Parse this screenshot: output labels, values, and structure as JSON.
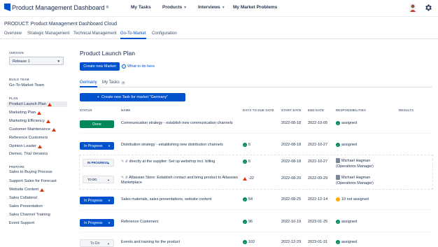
{
  "header": {
    "app_title": "Product Management Dashboard",
    "app_mark": "®",
    "nav": [
      {
        "label": "My Tasks",
        "dropdown": false
      },
      {
        "label": "Products",
        "dropdown": true
      },
      {
        "label": "Interviews",
        "dropdown": true
      },
      {
        "label": "My Market Problems",
        "dropdown": false
      }
    ]
  },
  "breadcrumb": "PRODUCT: Product Management Dashboard Cloud",
  "tabs": [
    {
      "label": "Overview",
      "active": false
    },
    {
      "label": "Strategic Management",
      "active": false
    },
    {
      "label": "Technical Management",
      "active": false
    },
    {
      "label": "Go-To-Market",
      "active": true
    },
    {
      "label": "Configuration",
      "active": false
    }
  ],
  "sidebar": {
    "version_heading": "VERSION",
    "version_value": "Release 1",
    "build_heading": "BUILD TEAM",
    "build_items": [
      "Go-To-Market Team"
    ],
    "plan_heading": "PLAN",
    "plan_items": [
      {
        "label": "Product Launch Plan",
        "warning": true,
        "selected": true
      },
      {
        "label": "Marketing Plan",
        "warning": true
      },
      {
        "label": "Marketing Efficiency",
        "warning": true
      },
      {
        "label": "Customer Maintenance",
        "warning": true
      },
      {
        "label": "Reference Customers",
        "warning": false
      },
      {
        "label": "Opinion Leader",
        "warning": true
      },
      {
        "label": "Demos, Trial Versions",
        "warning": false
      }
    ],
    "prepare_heading": "PREPARE",
    "prepare_items": [
      {
        "label": "Sales to Buying Process",
        "warning": false
      },
      {
        "label": "Support Sales for Forecast",
        "warning": false
      },
      {
        "label": "Website Content",
        "warning": true
      },
      {
        "label": "Sales Collateral",
        "warning": false
      },
      {
        "label": "Sales Presentation",
        "warning": false
      },
      {
        "label": "Sales Channel Training",
        "warning": false
      },
      {
        "label": "Event Support",
        "warning": false
      }
    ]
  },
  "main": {
    "title": "Product Launch Plan",
    "create_market_label": "Create new Market",
    "what_to_do_label": "What to do here",
    "subtabs": [
      {
        "label": "Germany",
        "active": true
      },
      {
        "label": "My Tasks",
        "count": "7",
        "active": false
      }
    ],
    "create_task_label": "Create new Task for market \"Germany\"",
    "columns": [
      "STATUS",
      "NAME",
      "DAYS TO DUE DATE",
      "START DATE",
      "END DATE",
      "RESPONSIBILITIES",
      "RESULTS"
    ],
    "rows": [
      {
        "status": "Done",
        "status_type": "done",
        "name": "Communication strategy - establish new communication channels",
        "days": "",
        "start": "2022-08-18",
        "end": "2022-10-05",
        "resp": "assigned",
        "resp_type": "ok"
      },
      {
        "status": "In Progress",
        "status_type": "progress",
        "name": "Distribution strategy - establishing new distribution channels",
        "days": "6",
        "start": "2022-08-18",
        "end": "2022-10-27",
        "resp": "assigned",
        "resp_type": "ok"
      },
      {
        "status": "IN PROGRESS",
        "status_type": "sub",
        "name": "directly at the supplier: Set up webshop incl. billing",
        "days": "6",
        "start": "2022-08-18",
        "end": "2022-10-27",
        "resp": "Michael Hagman",
        "resp2": "(Operations Manager)",
        "resp_type": "person"
      },
      {
        "status": "TO DO",
        "status_type": "subtodo",
        "name": "Atlassian Store: Establish contact and bring product to Atlassian Marketplace",
        "days": "-22",
        "start": "2022-08-20",
        "end": "2022-09-29",
        "resp": "Michael Hagman",
        "resp2": "(Operations Manager)",
        "resp_type": "person"
      },
      {
        "status": "In Progress",
        "status_type": "progress",
        "name": "Sales materials, sales presentations, website content",
        "days": "54",
        "start": "2022-08-25",
        "end": "2022-12-14",
        "resp": "10 not assigned",
        "resp_type": "warn"
      },
      {
        "status": "In Progress",
        "status_type": "progress",
        "name": "Reference Customers",
        "days": "96",
        "start": "2022-10-19",
        "end": "2023-01-25",
        "resp": "assigned",
        "resp_type": "ok"
      },
      {
        "status": "To Do",
        "status_type": "todo",
        "name": "Events and training for the product",
        "days": "102",
        "start": "2022-12-29",
        "end": "2023-01-31",
        "resp": "assigned",
        "resp_type": "ok"
      }
    ]
  }
}
